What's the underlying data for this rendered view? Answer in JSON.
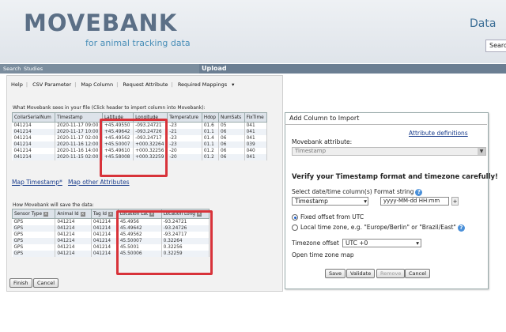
{
  "header": {
    "logo_text": "MOVEBANK",
    "tagline": "for animal tracking data",
    "right_title": "Data",
    "search_value": "Searc"
  },
  "nav": {
    "search": "Search",
    "studies": "Studies",
    "upload": "Upload"
  },
  "menu": [
    "Help",
    "CSV Parameter",
    "Map Column",
    "Request Attribute",
    "Required Mappings"
  ],
  "file_table": {
    "caption": "What Movebank sees in your file (Click header to import column into Movebank):",
    "headers": [
      "CollarSerialNum",
      "Timestamp",
      "Latitude",
      "Longitude",
      "Temperature",
      "Hdop",
      "NumSats",
      "FixTime"
    ],
    "rows": [
      [
        "041214",
        "2020-11-17 09:00",
        "+45.49550",
        "-093.24721",
        "-23",
        "01.6",
        "05",
        "041"
      ],
      [
        "041214",
        "2020-11-17 10:00",
        "+45.49642",
        "-093.24726",
        "-21",
        "01.1",
        "06",
        "041"
      ],
      [
        "041214",
        "2020-11-17 02:00",
        "+45.49562",
        "-093.24717",
        "-23",
        "01.4",
        "06",
        "041"
      ],
      [
        "041214",
        "2020-11-16 12:00",
        "+45.50007",
        "+000.32264",
        "-23",
        "01.1",
        "06",
        "039"
      ],
      [
        "041214",
        "2020-11-16 14:00",
        "+45.49610",
        "+000.32256",
        "-20",
        "01.2",
        "06",
        "040"
      ],
      [
        "041214",
        "2020-11-15 02:00",
        "+45.58008",
        "+000.32259",
        "-20",
        "01.2",
        "06",
        "041"
      ]
    ]
  },
  "links": {
    "map_timestamp": "Map Timestamp*",
    "map_other": "Map other Attributes"
  },
  "save_table": {
    "caption": "How Movebank will save the data:",
    "headers": [
      "Sensor Type",
      "Animal Id",
      "Tag Id",
      "Location Lat",
      "Location Long"
    ],
    "rows": [
      [
        "GPS",
        "041214",
        "041214",
        "45.4956",
        "-93.24721"
      ],
      [
        "GPS",
        "041214",
        "041214",
        "45.49642",
        "-93.24726"
      ],
      [
        "GPS",
        "041214",
        "041214",
        "45.49562",
        "-93.24717"
      ],
      [
        "GPS",
        "041214",
        "041214",
        "45.50007",
        "0.32264"
      ],
      [
        "GPS",
        "041214",
        "041214",
        "45.5001",
        "0.32256"
      ],
      [
        "GPS",
        "041214",
        "041214",
        "45.50006",
        "0.32259"
      ]
    ]
  },
  "buttons": {
    "finish": "Finish",
    "cancel": "Cancel",
    "save": "Save",
    "validate": "Validate",
    "remove": "Remove"
  },
  "add_column": {
    "title": "Add Column to Import",
    "attr_defs_link": "Attribute definitions",
    "movebank_attr_label": "Movebank attribute:",
    "movebank_attr_value": "Timestamp",
    "verify_heading": "Verify your Timestamp format and timezone carefully!",
    "select_label": "Select date/time column(s) Format string",
    "column_value": "Timestamp",
    "format_value": "yyyy-MM-dd HH:mm",
    "radio_fixed": "Fixed offset from UTC",
    "radio_local": "Local time zone, e.g. \"Europe/Berlin\" or \"Brazil/East\"",
    "tz_offset_label": "Timezone offset",
    "tz_offset_value": "UTC +0",
    "tz_map_text": "Open time zone map"
  },
  "colors": {
    "highlight": "#d8333a",
    "link": "#1a3d8c",
    "navbar": "#7b8d9e"
  }
}
